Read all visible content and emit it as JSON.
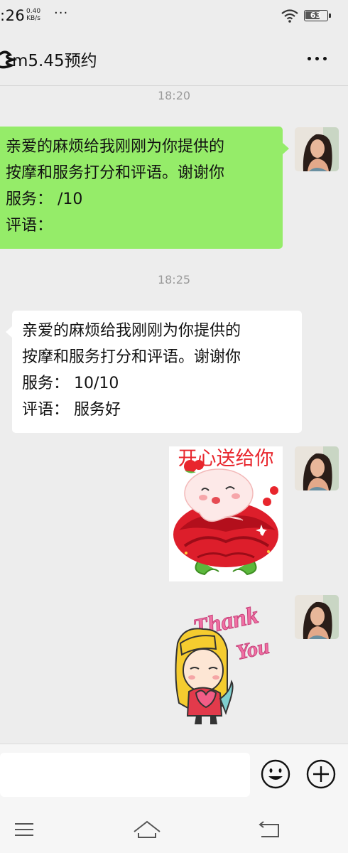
{
  "status_bar": {
    "time": ":26",
    "net_speed_value": "0.40",
    "net_speed_unit": "KB/s",
    "more_dots": "···",
    "battery_level": "63",
    "icons": [
      "wifi-icon",
      "battery-icon"
    ]
  },
  "header": {
    "title": "m5.45预约",
    "more_icon": "more-dots-icon"
  },
  "messages": [
    {
      "type": "timestamp",
      "text": "18:20"
    },
    {
      "type": "text",
      "side": "right",
      "lines": [
        "亲爱的麻烦给我刚刚为你提供的",
        "按摩和服务打分和评语。谢谢你",
        "服务：  /10",
        "评语："
      ]
    },
    {
      "type": "timestamp",
      "text": "18:25"
    },
    {
      "type": "text",
      "side": "left",
      "lines": [
        "亲爱的麻烦给我刚刚为你提供的",
        "按摩和服务打分和评语。谢谢你",
        "服务：   10/10",
        "评语：   服务好"
      ]
    },
    {
      "type": "sticker",
      "side": "right",
      "caption": "开心送给你"
    },
    {
      "type": "sticker",
      "side": "right",
      "caption_line1": "Thank",
      "caption_line2": "You"
    }
  ],
  "input_bar": {
    "placeholder": "",
    "emoji_icon": "emoji-smile-icon",
    "plus_icon": "plus-circle-icon"
  },
  "nav_bar": {
    "icons": [
      "menu-icon",
      "home-icon",
      "back-icon"
    ]
  },
  "colors": {
    "sent_bubble": "#95ec69",
    "received_bubble": "#ffffff",
    "chat_background": "#ededed"
  }
}
